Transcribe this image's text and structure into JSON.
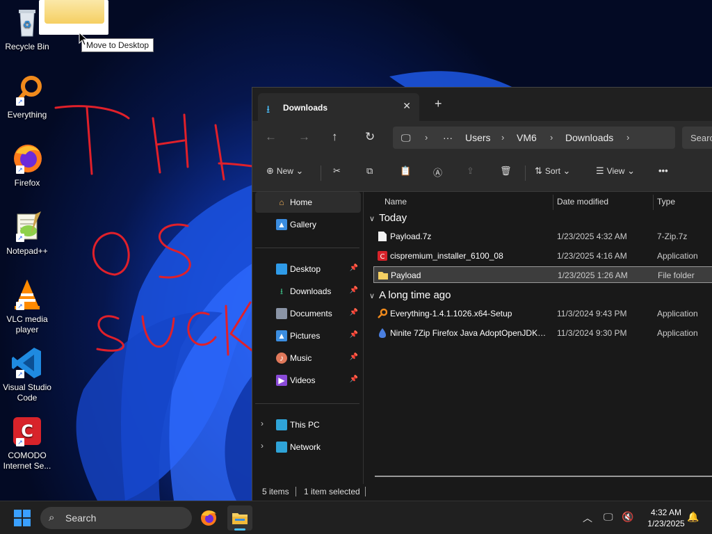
{
  "desktop": {
    "icons": [
      {
        "label": "Recycle Bin",
        "icon": "recycle-bin-icon"
      },
      {
        "label": "Everything",
        "icon": "everything-search-icon"
      },
      {
        "label": "Firefox",
        "icon": "firefox-icon"
      },
      {
        "label": "Notepad++",
        "icon": "notepad-plus-plus-icon"
      },
      {
        "label": "VLC media player",
        "icon": "vlc-icon"
      },
      {
        "label": "Visual Studio Code",
        "icon": "vscode-icon"
      },
      {
        "label": "COMODO Internet Se...",
        "icon": "comodo-icon"
      }
    ],
    "drag_tooltip": "Move to Desktop",
    "graffiti": "THIS OS SUCK"
  },
  "explorer": {
    "tab": {
      "title": "Downloads"
    },
    "address": {
      "segments": [
        "Users",
        "VM6",
        "Downloads"
      ],
      "search_placeholder": "Searc"
    },
    "commands": {
      "new": "New",
      "sort": "Sort",
      "view": "View"
    },
    "nav": {
      "quick": [
        {
          "label": "Home",
          "selected": true
        },
        {
          "label": "Gallery"
        }
      ],
      "pinned": [
        {
          "label": "Desktop"
        },
        {
          "label": "Downloads"
        },
        {
          "label": "Documents"
        },
        {
          "label": "Pictures"
        },
        {
          "label": "Music"
        },
        {
          "label": "Videos"
        }
      ],
      "roots": [
        {
          "label": "This PC"
        },
        {
          "label": "Network"
        }
      ]
    },
    "columns": {
      "name": "Name",
      "date": "Date modified",
      "type": "Type"
    },
    "groups": [
      {
        "title": "Today",
        "files": [
          {
            "name": "Payload.7z",
            "date": "1/23/2025 4:32 AM",
            "type": "7-Zip.7z"
          },
          {
            "name": "cispremium_installer_6100_08",
            "date": "1/23/2025 4:16 AM",
            "type": "Application"
          },
          {
            "name": "Payload",
            "date": "1/23/2025 1:26 AM",
            "type": "File folder"
          }
        ]
      },
      {
        "title": "A long time ago",
        "files": [
          {
            "name": "Everything-1.4.1.1026.x64-Setup",
            "date": "11/3/2024 9:43 PM",
            "type": "Application"
          },
          {
            "name": "Ninite 7Zip Firefox Java AdoptOpenJDK x...",
            "date": "11/3/2024 9:30 PM",
            "type": "Application"
          }
        ]
      }
    ],
    "status": {
      "count": "5 items",
      "selection": "1 item selected"
    }
  },
  "taskbar": {
    "search_label": "Search",
    "clock": {
      "time": "4:32 AM",
      "date": "1/23/2025"
    }
  },
  "colors": {
    "accent": "#4cc2ff",
    "window_bg": "#191919",
    "bar_bg": "#2b2b2b",
    "graffiti": "#e0202a"
  }
}
